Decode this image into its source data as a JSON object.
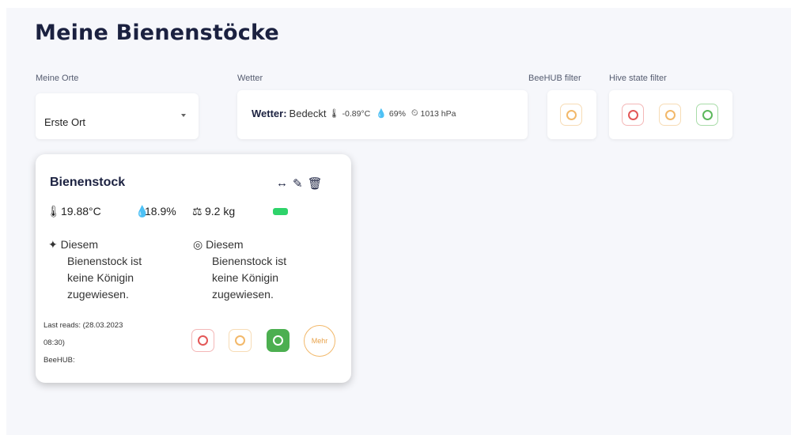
{
  "page": {
    "title": "Meine Bienenstöcke"
  },
  "labels": {
    "orte": "Meine Orte",
    "wetter": "Wetter",
    "beehub_filter": "BeeHUB filter",
    "hive_state_filter": "Hive state filter"
  },
  "location_select": {
    "value": "Erste Ort"
  },
  "weather": {
    "label": "Wetter:",
    "condition": "Bedeckt",
    "temperature": "-0.89°C",
    "humidity": "69%",
    "pressure": "1013 hPa"
  },
  "hive": {
    "name": "Bienenstock",
    "temperature": "19.88°C",
    "humidity": "18.9%",
    "weight": "9.2 kg",
    "queen_info_1": {
      "first": "Diesem",
      "rest": [
        "Bienenstock ist",
        "keine Königin",
        "zugewiesen."
      ]
    },
    "queen_info_2": {
      "first": "Diesem",
      "rest": [
        "Bienenstock ist",
        "keine Königin",
        "zugewiesen."
      ]
    },
    "last_reads_label": "Last reads: (28.03.2023",
    "last_reads_time": "08:30)",
    "beehub_label": "BeeHUB:",
    "more_button": "Mehr"
  },
  "colors": {
    "red": "#e35757",
    "orange": "#f2b86a",
    "green": "#4caf50",
    "battery": "#2ed36a"
  }
}
